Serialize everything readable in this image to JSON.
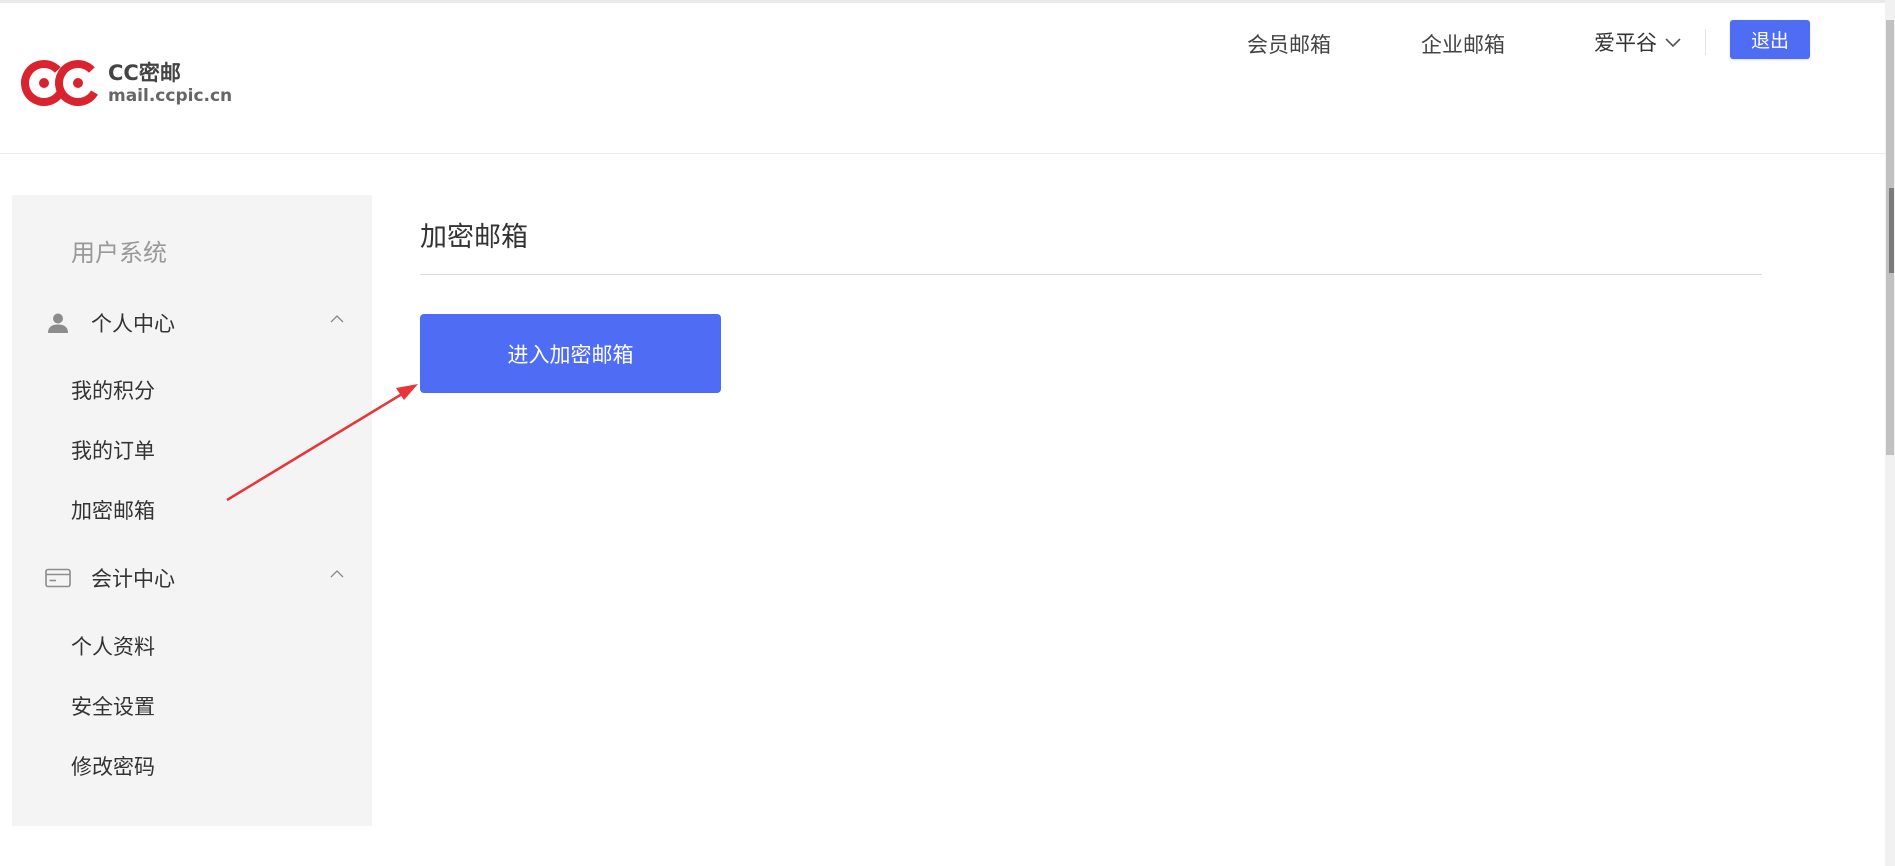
{
  "brand": {
    "logo_letters": "CC",
    "name": "CC密邮",
    "domain": "mail.ccpic.cn",
    "logo_color": "#d9232e"
  },
  "header": {
    "nav_member": "会员邮箱",
    "nav_enterprise": "企业邮箱",
    "username": "爱平谷",
    "logout_label": "退出"
  },
  "sidebar": {
    "title": "用户系统",
    "groups": [
      {
        "label": "个人中心",
        "icon": "user-icon",
        "expanded": true,
        "items": [
          {
            "label": "我的积分"
          },
          {
            "label": "我的订单"
          },
          {
            "label": "加密邮箱"
          }
        ]
      },
      {
        "label": "会计中心",
        "icon": "card-icon",
        "expanded": true,
        "items": [
          {
            "label": "个人资料"
          },
          {
            "label": "安全设置"
          },
          {
            "label": "修改密码"
          }
        ]
      }
    ]
  },
  "main": {
    "title": "加密邮箱",
    "enter_button_label": "进入加密邮箱"
  },
  "colors": {
    "accent": "#4f6cf5",
    "annotation_arrow": "#e8353a",
    "sidebar_bg": "#f4f4f4"
  }
}
